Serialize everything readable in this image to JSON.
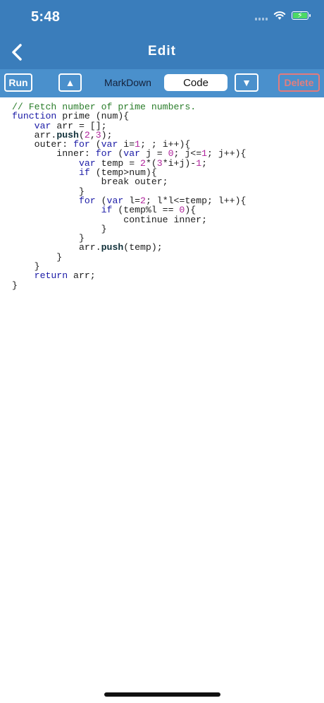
{
  "status": {
    "time": "5:48"
  },
  "navbar": {
    "title": "Edit",
    "back_icon": "chevron-left-icon"
  },
  "toolbar": {
    "run_label": "Run",
    "up_label": "▲",
    "tabs": [
      {
        "label": "MarkDown",
        "selected": false
      },
      {
        "label": "Code",
        "selected": true
      }
    ],
    "down_label": "▼",
    "delete_label": "Delete"
  },
  "code": {
    "lines": [
      [
        {
          "t": "// Fetch number of prime numbers.",
          "c": "comment"
        }
      ],
      [
        {
          "t": "function",
          "c": "kw"
        },
        {
          "t": " prime (num){",
          "c": ""
        }
      ],
      [
        {
          "t": "    ",
          "c": ""
        },
        {
          "t": "var",
          "c": "kw"
        },
        {
          "t": " arr = [];",
          "c": ""
        }
      ],
      [
        {
          "t": "    arr.",
          "c": ""
        },
        {
          "t": "push",
          "c": "fn"
        },
        {
          "t": "(",
          "c": ""
        },
        {
          "t": "2",
          "c": "num"
        },
        {
          "t": ",",
          "c": ""
        },
        {
          "t": "3",
          "c": "num"
        },
        {
          "t": ");",
          "c": ""
        }
      ],
      [
        {
          "t": "    outer: ",
          "c": ""
        },
        {
          "t": "for",
          "c": "kw"
        },
        {
          "t": " (",
          "c": ""
        },
        {
          "t": "var",
          "c": "kw"
        },
        {
          "t": " i=",
          "c": ""
        },
        {
          "t": "1",
          "c": "num"
        },
        {
          "t": "; ; i++){",
          "c": ""
        }
      ],
      [
        {
          "t": "        inner: ",
          "c": ""
        },
        {
          "t": "for",
          "c": "kw"
        },
        {
          "t": " (",
          "c": ""
        },
        {
          "t": "var",
          "c": "kw"
        },
        {
          "t": " j = ",
          "c": ""
        },
        {
          "t": "0",
          "c": "num"
        },
        {
          "t": "; j<=",
          "c": ""
        },
        {
          "t": "1",
          "c": "num"
        },
        {
          "t": "; j++){",
          "c": ""
        }
      ],
      [
        {
          "t": "            ",
          "c": ""
        },
        {
          "t": "var",
          "c": "kw"
        },
        {
          "t": " temp = ",
          "c": ""
        },
        {
          "t": "2",
          "c": "num"
        },
        {
          "t": "*(",
          "c": ""
        },
        {
          "t": "3",
          "c": "num"
        },
        {
          "t": "*i+j)-",
          "c": ""
        },
        {
          "t": "1",
          "c": "num"
        },
        {
          "t": ";",
          "c": ""
        }
      ],
      [
        {
          "t": "            ",
          "c": ""
        },
        {
          "t": "if",
          "c": "kw"
        },
        {
          "t": " (temp>num){",
          "c": ""
        }
      ],
      [
        {
          "t": "                break outer;",
          "c": ""
        }
      ],
      [
        {
          "t": "            }",
          "c": ""
        }
      ],
      [
        {
          "t": "            ",
          "c": ""
        },
        {
          "t": "for",
          "c": "kw"
        },
        {
          "t": " (",
          "c": ""
        },
        {
          "t": "var",
          "c": "kw"
        },
        {
          "t": " l=",
          "c": ""
        },
        {
          "t": "2",
          "c": "num"
        },
        {
          "t": "; l*l<=temp; l++){",
          "c": ""
        }
      ],
      [
        {
          "t": "                ",
          "c": ""
        },
        {
          "t": "if",
          "c": "kw"
        },
        {
          "t": " (temp%l == ",
          "c": ""
        },
        {
          "t": "0",
          "c": "num"
        },
        {
          "t": "){",
          "c": ""
        }
      ],
      [
        {
          "t": "                    continue inner;",
          "c": ""
        }
      ],
      [
        {
          "t": "                }",
          "c": ""
        }
      ],
      [
        {
          "t": "            }",
          "c": ""
        }
      ],
      [
        {
          "t": "            arr.",
          "c": ""
        },
        {
          "t": "push",
          "c": "fn"
        },
        {
          "t": "(temp);",
          "c": ""
        }
      ],
      [
        {
          "t": "        }",
          "c": ""
        }
      ],
      [
        {
          "t": "    }",
          "c": ""
        }
      ],
      [
        {
          "t": "    ",
          "c": ""
        },
        {
          "t": "return",
          "c": "kw"
        },
        {
          "t": " arr;",
          "c": ""
        }
      ],
      [
        {
          "t": "}",
          "c": ""
        }
      ]
    ]
  }
}
